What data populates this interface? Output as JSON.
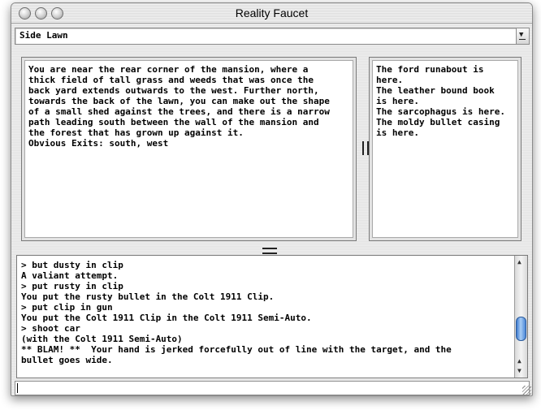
{
  "window": {
    "title": "Reality Faucet"
  },
  "location": {
    "value": "Side Lawn"
  },
  "description": {
    "text": "You are near the rear corner of the mansion, where a\nthick field of tall grass and weeds that was once the\nback yard extends outwards to the west. Further north,\ntowards the back of the lawn, you can make out the shape\nof a small shed against the trees, and there is a narrow\npath leading south between the wall of the mansion and\nthe forest that has grown up against it.\nObvious Exits: south, west"
  },
  "objects": {
    "text": "The ford runabout is\nhere.\nThe leather bound book\nis here.\nThe sarcophagus is here.\nThe moldy bullet casing\nis here."
  },
  "output": {
    "text": "> but dusty in clip\nA valiant attempt.\n> put rusty in clip\nYou put the rusty bullet in the Colt 1911 Clip.\n> put clip in gun\nYou put the Colt 1911 Clip in the Colt 1911 Semi-Auto.\n> shoot car\n(with the Colt 1911 Semi-Auto)\n** BLAM! **  Your hand is jerked forcefully out of line with the target, and the\nbullet goes wide.",
    "scroll_position": 0.78
  },
  "input": {
    "value": ""
  }
}
